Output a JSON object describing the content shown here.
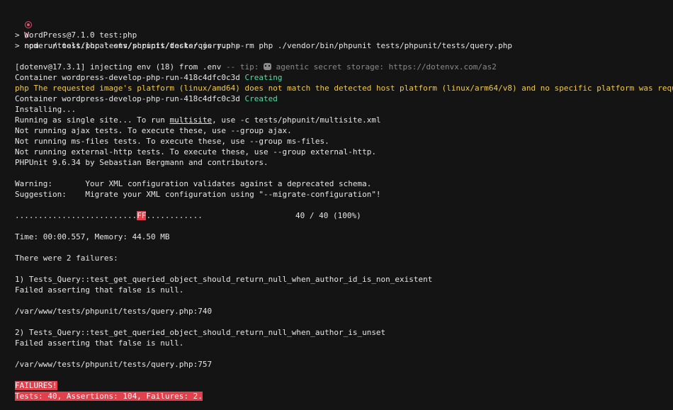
{
  "command": "npm run test:php tests/phpunit/tests/query.php",
  "script_lines": [
    "> WordPress@7.1.0 test:php",
    "> node ./tools/local-env/scripts/docker.js run --rm php ./vendor/bin/phpunit tests/phpunit/tests/query.php"
  ],
  "dotenv": {
    "main": "[dotenv@17.3.1] injecting env (18) from .env",
    "tip_prefix": " -- tip: ",
    "tip_text": " agentic secret storage: https://dotenvx.com/as2"
  },
  "container_creating": {
    "name": "Container wordpress-develop-php-run-418c4dfc0c3d",
    "status": "Creating"
  },
  "platform_warning": {
    "prefix": "php",
    "message": "The requested image's platform (linux/amd64) does not match the detected host platform (linux/arm64/v8) and no specific platform was requested"
  },
  "container_created": {
    "name": "Container wordpress-develop-php-run-418c4dfc0c3d",
    "status": "Created"
  },
  "installing": "Installing...",
  "single_site": {
    "before": "Running as single site... To run ",
    "link": "multisite",
    "after": ", use -c tests/phpunit/multisite.xml"
  },
  "not_running": [
    "Not running ajax tests. To execute these, use --group ajax.",
    "Not running ms-files tests. To execute these, use --group ms-files.",
    "Not running external-http tests. To execute these, use --group external-http."
  ],
  "phpunit_version": "PHPUnit 9.6.34 by Sebastian Bergmann and contributors.",
  "warning": "Warning:       Your XML configuration validates against a deprecated schema.",
  "suggestion": "Suggestion:    Migrate your XML configuration using \"--migrate-configuration\"!",
  "progress": {
    "dots_before": "..........................",
    "failures": "FF",
    "dots_after": "............",
    "count": "40 / 40 (100%)"
  },
  "time_memory": "Time: 00:00.557, Memory: 44.50 MB",
  "failures_header": "There were 2 failures:",
  "failures": [
    {
      "title": "1) Tests_Query::test_get_queried_object_should_return_null_when_author_id_is_non_existent",
      "message": "Failed asserting that false is null.",
      "location": "/var/www/tests/phpunit/tests/query.php:740"
    },
    {
      "title": "2) Tests_Query::test_get_queried_object_should_return_null_when_author_is_unset",
      "message": "Failed asserting that false is null.",
      "location": "/var/www/tests/phpunit/tests/query.php:757"
    }
  ],
  "summary": {
    "label": "FAILURES!",
    "stats": "Tests: 40, Assertions: 104, Failures: 2."
  },
  "colors": {
    "background": "#141414",
    "text": "#e6e6e6",
    "success": "#5fd7a7",
    "warning": "#f2c94c",
    "failure": "#e0414c",
    "dim": "#8a8a8a"
  },
  "icons": {
    "prompt": "record-circle-icon",
    "chevron": "chevron-right-icon",
    "tip": "robot-icon"
  }
}
